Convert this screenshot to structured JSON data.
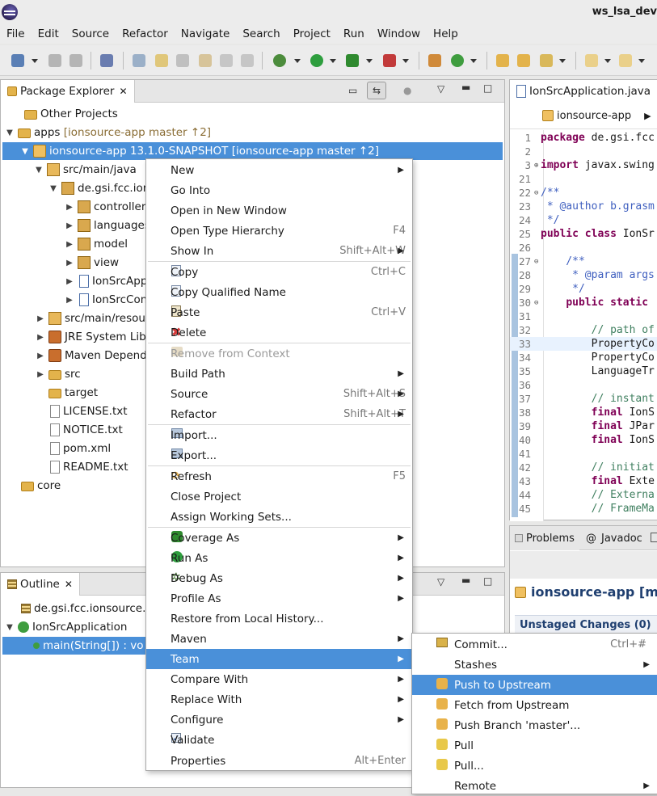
{
  "window": {
    "title": "ws_lsa_dev"
  },
  "menubar": [
    "File",
    "Edit",
    "Source",
    "Refactor",
    "Navigate",
    "Search",
    "Project",
    "Run",
    "Window",
    "Help"
  ],
  "package_explorer": {
    "tab_label": "Package Explorer",
    "tree": [
      {
        "label": "Other Projects",
        "suffix": ""
      },
      {
        "label": "apps",
        "suffix": "[ionsource-app master ↑2]"
      },
      {
        "label": "ionsource-app  13.1.0-SNAPSHOT",
        "suffix": "[ionsource-app master ↑2]"
      },
      {
        "label": "src/main/java",
        "suffix": ""
      },
      {
        "label": "de.gsi.fcc.ion",
        "suffix": ""
      },
      {
        "label": "controller",
        "suffix": ""
      },
      {
        "label": "languages",
        "suffix": ""
      },
      {
        "label": "model",
        "suffix": ""
      },
      {
        "label": "view",
        "suffix": ""
      },
      {
        "label": "IonSrcApp",
        "suffix": ""
      },
      {
        "label": "IonSrcCon",
        "suffix": ""
      },
      {
        "label": "src/main/resou",
        "suffix": ""
      },
      {
        "label": "JRE System Libr",
        "suffix": ""
      },
      {
        "label": "Maven Depende",
        "suffix": ""
      },
      {
        "label": "src",
        "suffix": ""
      },
      {
        "label": "target",
        "suffix": ""
      },
      {
        "label": "LICENSE.txt",
        "suffix": ""
      },
      {
        "label": "NOTICE.txt",
        "suffix": ""
      },
      {
        "label": "pom.xml",
        "suffix": ""
      },
      {
        "label": "README.txt",
        "suffix": ""
      },
      {
        "label": "core",
        "suffix": ""
      }
    ]
  },
  "outline": {
    "tab_label": "Outline",
    "items": [
      {
        "label": "de.gsi.fcc.ionsource."
      },
      {
        "label": "IonSrcApplication"
      },
      {
        "label": "main(String[]) : vo"
      }
    ]
  },
  "editor": {
    "tab_label": "IonSrcApplication.java",
    "breadcrumb": "ionsource-app",
    "lines": [
      {
        "n": "1",
        "code": "package de.gsi.fcc"
      },
      {
        "n": "2",
        "code": ""
      },
      {
        "n": "3",
        "code": "import javax.swing"
      },
      {
        "n": "21",
        "code": ""
      },
      {
        "n": "22",
        "code": "/**"
      },
      {
        "n": "23",
        "code": " * @author b.grasm"
      },
      {
        "n": "24",
        "code": " */"
      },
      {
        "n": "25",
        "code": "public class IonSr"
      },
      {
        "n": "26",
        "code": ""
      },
      {
        "n": "27",
        "code": "    /**"
      },
      {
        "n": "28",
        "code": "     * @param args"
      },
      {
        "n": "29",
        "code": "     */"
      },
      {
        "n": "30",
        "code": "    public static"
      },
      {
        "n": "31",
        "code": ""
      },
      {
        "n": "32",
        "code": "        // path of"
      },
      {
        "n": "33",
        "code": "        PropertyCo"
      },
      {
        "n": "34",
        "code": "        PropertyCo"
      },
      {
        "n": "35",
        "code": "        LanguageTr"
      },
      {
        "n": "36",
        "code": ""
      },
      {
        "n": "37",
        "code": "        // instant"
      },
      {
        "n": "38",
        "code": "        final IonS"
      },
      {
        "n": "39",
        "code": "        final JPar"
      },
      {
        "n": "40",
        "code": "        final IonS"
      },
      {
        "n": "41",
        "code": ""
      },
      {
        "n": "42",
        "code": "        // initiat"
      },
      {
        "n": "43",
        "code": "        final Exte"
      },
      {
        "n": "44",
        "code": "        // Externa"
      },
      {
        "n": "45",
        "code": "        // FrameMa"
      }
    ]
  },
  "bottom_right": {
    "tabs": [
      "Problems",
      "Javadoc"
    ],
    "repo_title": "ionsource-app [m",
    "unstaged": "Unstaged Changes (0)"
  },
  "context_menu": [
    {
      "label": "New",
      "shortcut": "",
      "submenu": true
    },
    {
      "label": "Go Into",
      "shortcut": ""
    },
    {
      "label": "Open in New Window",
      "shortcut": ""
    },
    {
      "label": "Open Type Hierarchy",
      "shortcut": "F4"
    },
    {
      "label": "Show In",
      "shortcut": "Shift+Alt+W",
      "submenu": true
    },
    {
      "label": "Copy",
      "shortcut": "Ctrl+C"
    },
    {
      "label": "Copy Qualified Name",
      "shortcut": ""
    },
    {
      "label": "Paste",
      "shortcut": "Ctrl+V"
    },
    {
      "label": "Delete",
      "shortcut": ""
    },
    {
      "label": "Remove from Context",
      "shortcut": ""
    },
    {
      "label": "Build Path",
      "shortcut": "",
      "submenu": true
    },
    {
      "label": "Source",
      "shortcut": "Shift+Alt+S",
      "submenu": true
    },
    {
      "label": "Refactor",
      "shortcut": "Shift+Alt+T",
      "submenu": true
    },
    {
      "label": "Import...",
      "shortcut": ""
    },
    {
      "label": "Export...",
      "shortcut": ""
    },
    {
      "label": "Refresh",
      "shortcut": "F5"
    },
    {
      "label": "Close Project",
      "shortcut": ""
    },
    {
      "label": "Assign Working Sets...",
      "shortcut": ""
    },
    {
      "label": "Coverage As",
      "shortcut": "",
      "submenu": true
    },
    {
      "label": "Run As",
      "shortcut": "",
      "submenu": true
    },
    {
      "label": "Debug As",
      "shortcut": "",
      "submenu": true
    },
    {
      "label": "Profile As",
      "shortcut": "",
      "submenu": true
    },
    {
      "label": "Restore from Local History...",
      "shortcut": ""
    },
    {
      "label": "Maven",
      "shortcut": "",
      "submenu": true
    },
    {
      "label": "Team",
      "shortcut": "",
      "submenu": true
    },
    {
      "label": "Compare With",
      "shortcut": "",
      "submenu": true
    },
    {
      "label": "Replace With",
      "shortcut": "",
      "submenu": true
    },
    {
      "label": "Configure",
      "shortcut": "",
      "submenu": true
    },
    {
      "label": "Validate",
      "shortcut": ""
    },
    {
      "label": "Properties",
      "shortcut": "Alt+Enter"
    }
  ],
  "team_submenu": [
    {
      "label": "Commit...",
      "shortcut": "Ctrl+#"
    },
    {
      "label": "Stashes",
      "shortcut": "",
      "submenu": true
    },
    {
      "label": "Push to Upstream",
      "shortcut": ""
    },
    {
      "label": "Fetch from Upstream",
      "shortcut": ""
    },
    {
      "label": "Push Branch 'master'...",
      "shortcut": ""
    },
    {
      "label": "Pull",
      "shortcut": ""
    },
    {
      "label": "Pull...",
      "shortcut": ""
    },
    {
      "label": "Remote",
      "shortcut": "",
      "submenu": true
    }
  ],
  "colors": {
    "selection": "#4a90d9",
    "keyword": "#7f0055",
    "comment": "#3f7f5f",
    "javadoc": "#3f5fbf"
  }
}
